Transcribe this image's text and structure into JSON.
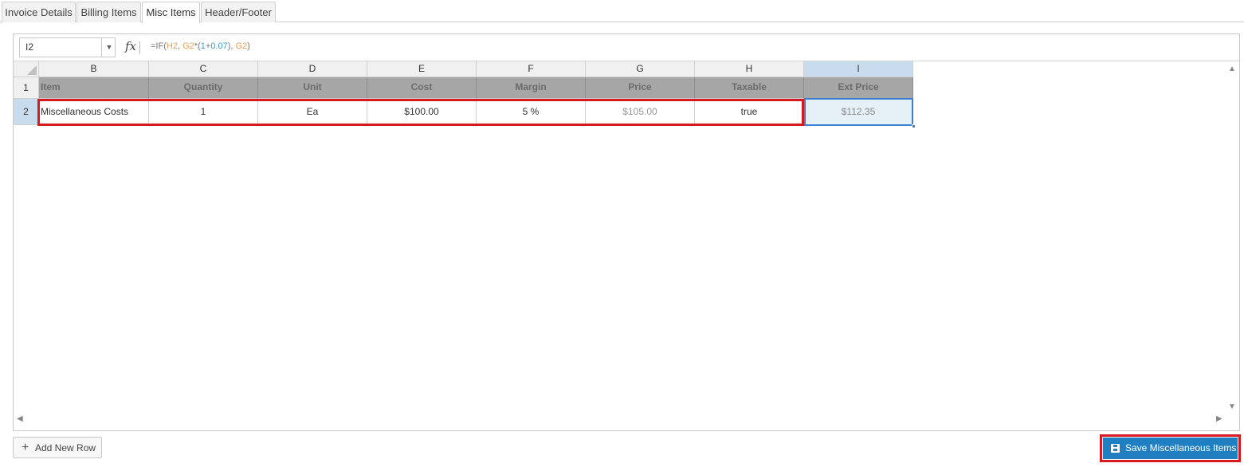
{
  "tabs": [
    {
      "label": "Invoice Details",
      "active": false
    },
    {
      "label": "Billing Items",
      "active": false
    },
    {
      "label": "Misc Items",
      "active": true
    },
    {
      "label": "Header/Footer",
      "active": false
    }
  ],
  "formula_bar": {
    "cell_ref": "I2",
    "fx_symbol": "fx",
    "formula_parts": {
      "p1": "=IF(",
      "p2": "H2",
      "p3": ", ",
      "p4": "G2",
      "p5": "*(",
      "p6": "1",
      "p7": "+",
      "p8": "0.07",
      "p9": "), ",
      "p10": "G2",
      "p11": ")"
    }
  },
  "sheet": {
    "column_letters": [
      "B",
      "C",
      "D",
      "E",
      "F",
      "G",
      "H",
      "I"
    ],
    "selected_column": "I",
    "row_numbers": [
      "1",
      "2"
    ],
    "header_row": [
      "Item",
      "Quantity",
      "Unit",
      "Cost",
      "Margin",
      "Price",
      "Taxable",
      "Ext Price"
    ],
    "data_row": [
      "Miscellaneous Costs",
      "1",
      "Ea",
      "$100.00",
      "5 %",
      "$105.00",
      "true",
      "$112.35"
    ]
  },
  "buttons": {
    "add_new_row": "Add New Row",
    "save_misc_items": "Save Miscellaneous Items"
  },
  "colors": {
    "highlight_red": "#d71920",
    "save_blue": "#1f7fc1",
    "header_gray": "#a6a6a6",
    "selection_blue": "#c9dced"
  }
}
